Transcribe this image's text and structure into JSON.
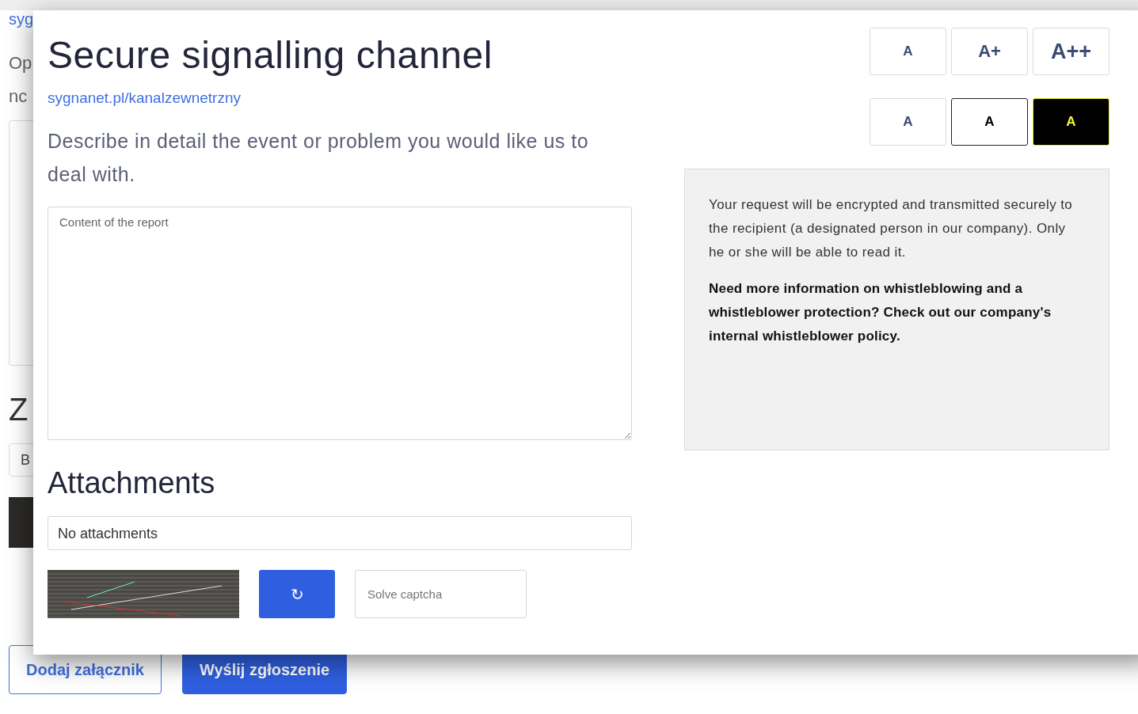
{
  "background": {
    "link": "syg",
    "text_lines": [
      "Op",
      "nc"
    ],
    "heading": "Z",
    "field_value": "B",
    "buttons": [
      {
        "label": "Dodaj załącznik",
        "kind": "outline"
      },
      {
        "label": "Wyślij zgłoszenie",
        "kind": "primary"
      }
    ]
  },
  "modal": {
    "title": "Secure signalling channel",
    "link": "sygnanet.pl/kanalzewnetrzny",
    "description": "Describe in detail the event or problem you would like us to deal with.",
    "report_field": {
      "placeholder": "Content of the report"
    },
    "font_size_buttons": [
      {
        "label": "A",
        "kind": "normal"
      },
      {
        "label": "A+",
        "kind": "large"
      },
      {
        "label": "A++",
        "kind": "larger"
      }
    ],
    "contrast_buttons": [
      {
        "label": "A",
        "kind": "default"
      },
      {
        "label": "A",
        "kind": "black-on-white"
      },
      {
        "label": "A",
        "kind": "yellow-on-black"
      }
    ],
    "info": {
      "text": "Your request will be encrypted and transmitted securely to the recipient (a designated person in our company). Only he or she will be able to read it.",
      "note": "Need more information on whistleblowing and a whistleblower protection? Check out our company's internal whistleblower policy."
    },
    "attachments": {
      "heading": "Attachments",
      "value": "No attachments"
    },
    "captcha": {
      "refresh_label": "↻",
      "placeholder": "Solve captcha"
    }
  }
}
